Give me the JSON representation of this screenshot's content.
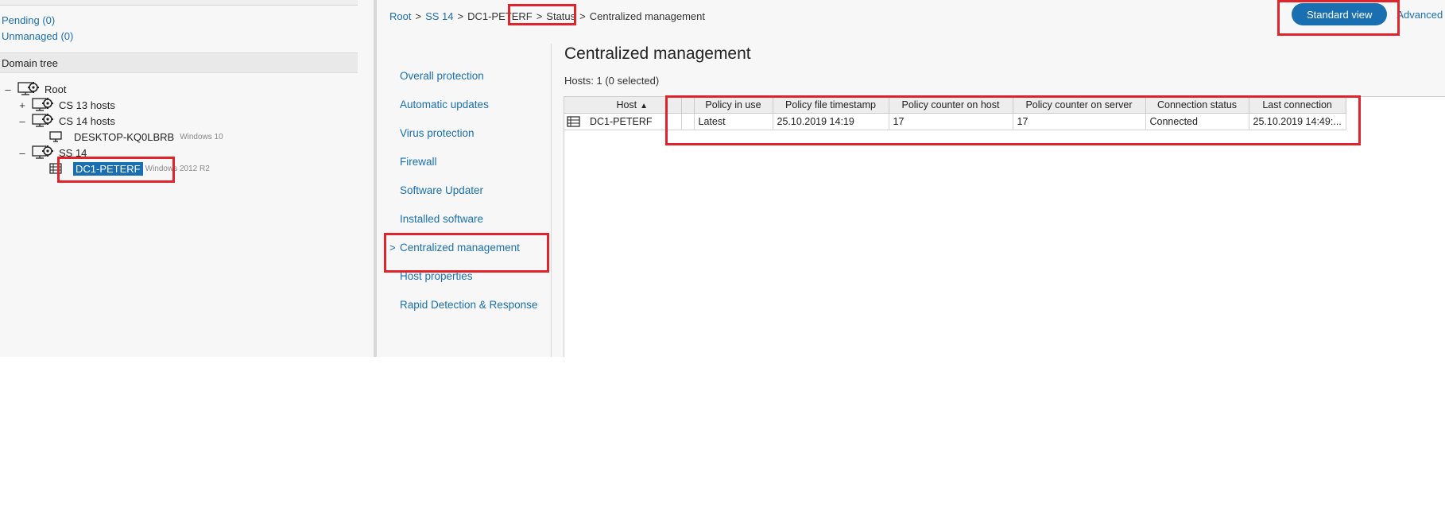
{
  "left": {
    "pending": "Pending (0)",
    "unmanaged": "Unmanaged (0)",
    "domain_tree_header": "Domain tree"
  },
  "tree": {
    "root": {
      "toggle": "–",
      "label": "Root",
      "icon": "server-group-gear-icon"
    },
    "cs13": {
      "toggle": "+",
      "label": "CS 13 hosts",
      "icon": "server-group-gear-icon"
    },
    "cs14": {
      "toggle": "–",
      "label": "CS 14 hosts",
      "icon": "server-group-gear-icon"
    },
    "desktop": {
      "label": "DESKTOP-KQ0LBRB",
      "os": "Windows 10",
      "icon": "monitor-icon"
    },
    "ss14": {
      "toggle": "–",
      "label": "SS 14",
      "icon": "server-group-gear-icon"
    },
    "dc1": {
      "label": "DC1-PETERF",
      "os": "Windows 2012 R2",
      "icon": "server-icon"
    }
  },
  "breadcrumb": {
    "root": "Root",
    "ss14": "SS 14",
    "host": "DC1-PETERF",
    "status": "Status",
    "current": "Centralized management",
    "separator": ">"
  },
  "view_toggle": {
    "standard": "Standard view",
    "advanced": "Advanced"
  },
  "nav": {
    "items": [
      "Overall protection",
      "Automatic updates",
      "Virus protection",
      "Firewall",
      "Software Updater",
      "Installed software",
      "Centralized management",
      "Host properties",
      "Rapid Detection & Response"
    ],
    "selected_arrow": ">"
  },
  "content": {
    "title": "Centralized management",
    "hosts_count": "Hosts: 1 (0 selected)"
  },
  "table": {
    "columns": [
      "Host",
      "Policy in use",
      "Policy file timestamp",
      "Policy counter on host",
      "Policy counter on server",
      "Connection status",
      "Last connection"
    ],
    "sort_indicator": "▲",
    "rows": [
      {
        "host": "DC1-PETERF",
        "policy_in_use": "Latest",
        "policy_file_timestamp": "25.10.2019 14:19",
        "policy_counter_on_host": "17",
        "policy_counter_on_server": "17",
        "connection_status": "Connected",
        "last_connection": "25.10.2019 14:49:..."
      }
    ]
  },
  "colors": {
    "accent": "#1a6fb0",
    "highlight": "#e0242b",
    "pane_bg": "#f7f7f7"
  }
}
